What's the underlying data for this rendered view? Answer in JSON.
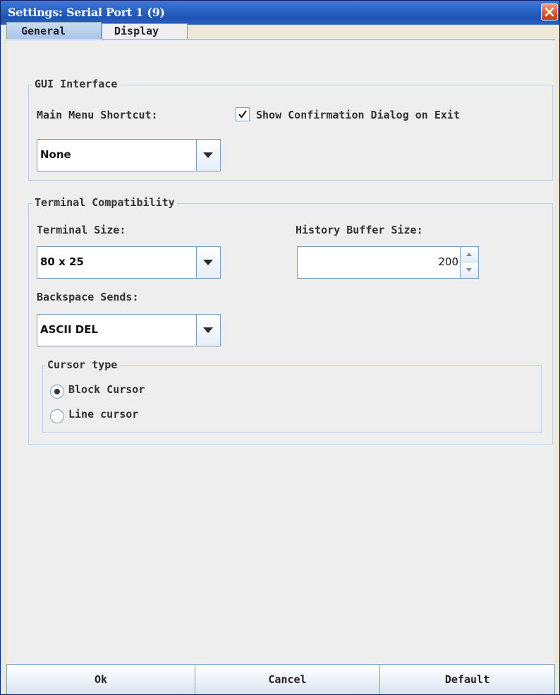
{
  "window": {
    "title": "Settings: Serial Port 1 (9)"
  },
  "tabs": [
    {
      "label": "General",
      "selected": true
    },
    {
      "label": "Display",
      "selected": false
    }
  ],
  "gui_interface": {
    "title": "GUI Interface",
    "main_menu_shortcut_label": "Main Menu Shortcut:",
    "main_menu_shortcut_value": "None",
    "show_confirmation_label": "Show Confirmation Dialog on Exit",
    "show_confirmation_checked": true
  },
  "terminal_compat": {
    "title": "Terminal Compatibility",
    "terminal_size_label": "Terminal Size:",
    "terminal_size_value": "80 x 25",
    "history_buffer_label": "History Buffer Size:",
    "history_buffer_value": "200",
    "backspace_label": "Backspace Sends:",
    "backspace_value": "ASCII DEL",
    "cursor_type": {
      "title": "Cursor type",
      "options": [
        {
          "label": "Block Cursor",
          "selected": true
        },
        {
          "label": "Line cursor",
          "selected": false
        }
      ]
    }
  },
  "footer": {
    "ok": "Ok",
    "cancel": "Cancel",
    "default": "Default"
  },
  "colors": {
    "titlebar": "#2a64c6",
    "close": "#e2572b",
    "border": "#7f9db9"
  }
}
